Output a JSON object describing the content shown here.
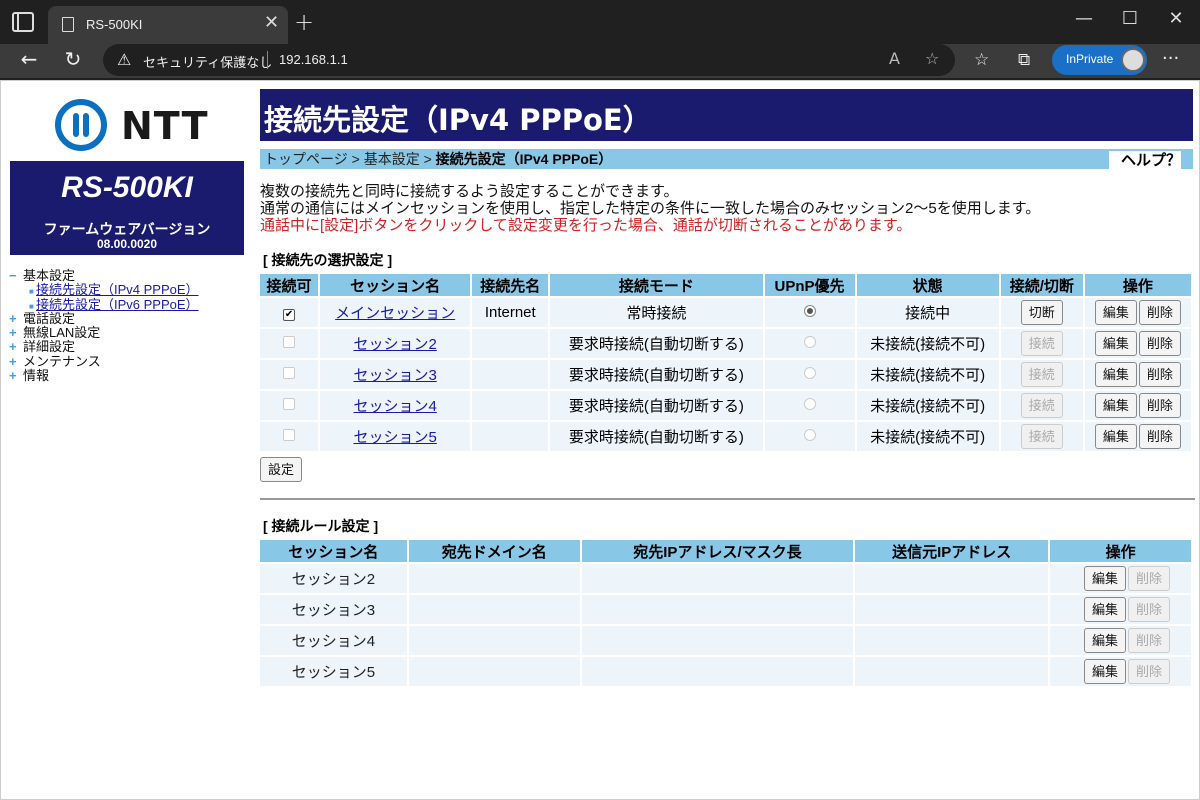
{
  "browser": {
    "tab_title": "RS-500KI",
    "security_label": "セキュリティ保護なし",
    "url": "192.168.1.1",
    "inprivate_label": "InPrivate"
  },
  "sidebar": {
    "logo_text": "NTT",
    "model": "RS-500KI",
    "firmware_label": "ファームウェアバージョン",
    "firmware_version": "08.00.0020",
    "menu": [
      {
        "label": "基本設定",
        "expanded": true,
        "children": [
          "接続先設定（IPv4 PPPoE）",
          "接続先設定（IPv6 PPPoE）"
        ]
      },
      {
        "label": "電話設定",
        "expanded": false
      },
      {
        "label": "無線LAN設定",
        "expanded": false
      },
      {
        "label": "詳細設定",
        "expanded": false
      },
      {
        "label": "メンテナンス",
        "expanded": false
      },
      {
        "label": "情報",
        "expanded": false
      }
    ]
  },
  "header": {
    "title": "接続先設定（IPv4 PPPoE）",
    "breadcrumb": [
      "トップページ",
      "基本設定",
      "接続先設定（IPv4 PPPoE）"
    ],
    "breadcrumb_sep": " > ",
    "help": "ヘルプ？"
  },
  "description": {
    "line1": "複数の接続先と同時に接続するよう設定することができます。",
    "line2": "通常の通信にはメインセッションを使用し、指定した特定の条件に一致した場合のみセッション2〜5を使用します。",
    "warning": "通話中に[設定]ボタンをクリックして設定変更を行った場合、通話が切断されることがあります。"
  },
  "selection": {
    "title": "[ 接続先の選択設定 ]",
    "headers": [
      "接続可",
      "セッション名",
      "接続先名",
      "接続モード",
      "UPnP優先",
      "状態",
      "接続/切断",
      "操作"
    ],
    "rows": [
      {
        "session": "メインセッション",
        "dest": "Internet",
        "mode": "常時接続",
        "state": "接続中",
        "connect_btn": "切断"
      },
      {
        "session": "セッション2",
        "dest": "",
        "mode": "要求時接続(自動切断する)",
        "state": "未接続(接続不可)",
        "connect_btn": "接続"
      },
      {
        "session": "セッション3",
        "dest": "",
        "mode": "要求時接続(自動切断する)",
        "state": "未接続(接続不可)",
        "connect_btn": "接続"
      },
      {
        "session": "セッション4",
        "dest": "",
        "mode": "要求時接続(自動切断する)",
        "state": "未接続(接続不可)",
        "connect_btn": "接続"
      },
      {
        "session": "セッション5",
        "dest": "",
        "mode": "要求時接続(自動切断する)",
        "state": "未接続(接続不可)",
        "connect_btn": "接続"
      }
    ],
    "edit_label": "編集",
    "delete_label": "削除",
    "check_mark": "✔",
    "set_button": "設定"
  },
  "rules": {
    "title": "[ 接続ルール設定 ]",
    "headers": [
      "セッション名",
      "宛先ドメイン名",
      "宛先IPアドレス/マスク長",
      "送信元IPアドレス",
      "操作"
    ],
    "rows": [
      {
        "session": "セッション2"
      },
      {
        "session": "セッション3"
      },
      {
        "session": "セッション4"
      },
      {
        "session": "セッション5"
      }
    ],
    "edit_label": "編集",
    "delete_label": "削除"
  }
}
